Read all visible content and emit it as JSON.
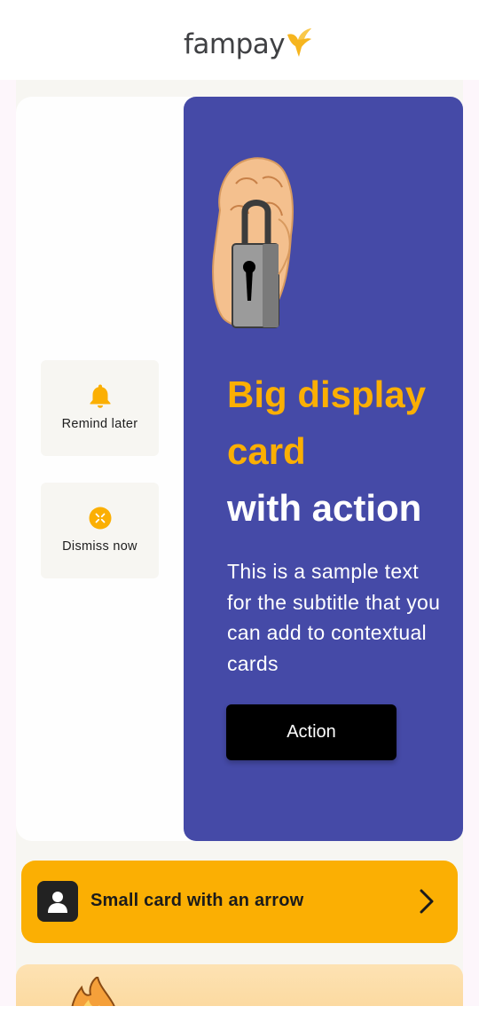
{
  "header": {
    "logo_text": "fampay",
    "logo_icon": "bird-icon"
  },
  "slide_actions": [
    {
      "label": "Remind later",
      "icon": "bell-icon"
    },
    {
      "label": "Dismiss now",
      "icon": "dismiss-icon"
    }
  ],
  "big_card": {
    "illustration": "hand-with-padlock",
    "title_line1": "Big display",
    "title_line2": "card",
    "title_line3": "with action",
    "subtitle": "This is a sample text for the subtitle that you can add to contextual cards",
    "cta_label": "Action",
    "background_color": "#454aa7",
    "highlight_color": "#fbaf03"
  },
  "small_card": {
    "title": "Small card with an arrow",
    "icon": "user-icon",
    "arrow_icon": "chevron-right-icon",
    "background_color": "#fbaf03"
  },
  "next_card": {
    "illustration": "flame-icon"
  }
}
